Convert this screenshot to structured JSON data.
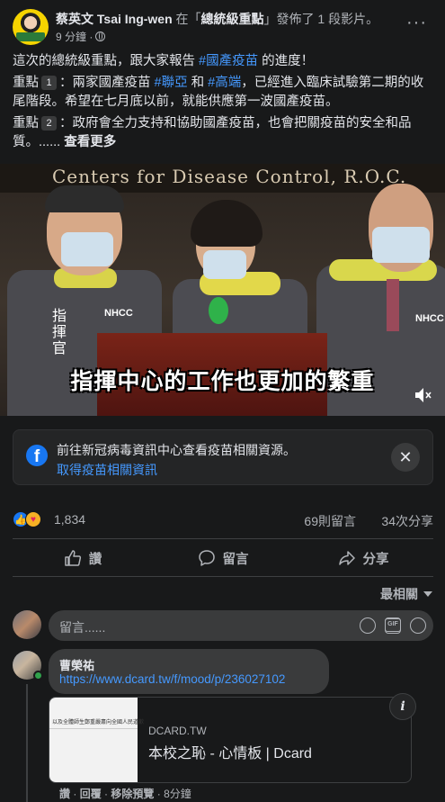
{
  "post": {
    "author": "蔡英文 Tsai Ing-wen",
    "in_text": " 在「",
    "group": "總統級重點",
    "posted_text": "」發佈了 1 段影片。",
    "time": "9 分鐘 ·",
    "more": "···"
  },
  "text": {
    "line1_pre": "這次的總統級重點，跟大家報告 ",
    "line1_tag": "#國產疫苗",
    "line1_post": " 的進度！",
    "p2_pre": "重點",
    "p2_num": "1",
    "p2_a": "：兩家國產疫苗 ",
    "p2_tag1": "#聯亞",
    "p2_and": " 和 ",
    "p2_tag2": "#高端",
    "p2_b": "，已經進入臨床試驗第二期的收尾階段。希望在七月底以前，就能供應第一波國產疫苗。",
    "p3_pre": "重點",
    "p3_num": "2",
    "p3_a": "：政府會全力支持和協助國產疫苗，也會把關疫苗的安全和品質。......",
    "see_more": " 查看更多"
  },
  "video": {
    "banner": "Centers for Disease Control, R.O.C.",
    "subtitle": "指揮中心的工作也更加的繁重",
    "vest_left": "NHCC",
    "vest_right": "NHCC",
    "role": "指揮官"
  },
  "info_card": {
    "text": "前往新冠病毒資訊中心查看疫苗相關資源。",
    "link": "取得疫苗相關資訊",
    "close": "✕"
  },
  "reactions": {
    "count": "1,834",
    "comments": "69則留言",
    "shares": "34次分享"
  },
  "actions": {
    "like": "讚",
    "comment": "留言",
    "share": "分享"
  },
  "sort": {
    "label": "最相關"
  },
  "composer": {
    "placeholder": "留言......",
    "gif": "GIF"
  },
  "comment": {
    "name": "曹榮祐",
    "link": "https://www.dcard.tw/f/mood/p/236027102",
    "card_site": "DCARD.TW",
    "card_title": "本校之恥 - 心情板 | Dcard",
    "card_thumb_text": "以及全體師生鄭重嚴肅向全國人民道歉",
    "info": "i",
    "like": "讚",
    "reply": "回覆",
    "remove_preview": "移除預覽",
    "time": "8分鐘",
    "sep": " · "
  },
  "colors": {
    "background": "#18191a",
    "link": "#4599ff",
    "facebook_blue": "#1877f2"
  }
}
